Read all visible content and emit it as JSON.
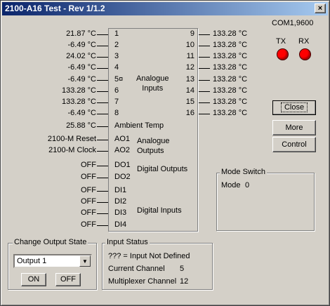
{
  "window": {
    "title": "2100-A16 Test - Rev 1/1.2",
    "close_glyph": "×"
  },
  "com_port": "COM1,9600",
  "leds": {
    "tx_label": "TX",
    "rx_label": "RX",
    "tx_color": "#ff0000",
    "rx_color": "#ff0000"
  },
  "left_values": [
    "21.87 °C",
    "-6.49 °C",
    "24.02 °C",
    "-6.49 °C",
    "-6.49 °C",
    "133.28 °C",
    "133.28 °C",
    "-6.49 °C"
  ],
  "left_pins": [
    "1",
    "2",
    "3",
    "4",
    "5¤",
    "6",
    "7",
    "8"
  ],
  "right_pins": [
    "9",
    "10",
    "11",
    "12",
    "13",
    "14",
    "15",
    "16"
  ],
  "right_values": [
    "133.28 °C",
    "133.28 °C",
    "133.28 °C",
    "133.28 °C",
    "133.28 °C",
    "133.28 °C",
    "133.28 °C",
    "133.28 °C"
  ],
  "analogue_inputs_label": "Analogue\nInputs",
  "ambient": {
    "value": "25.88 °C",
    "label": "Ambient Temp"
  },
  "analogue_outputs": {
    "label": "Analogue\nOutputs",
    "rows": [
      {
        "value": "2100-M Reset",
        "pin": "AO1"
      },
      {
        "value": "2100-M Clock",
        "pin": "AO2"
      }
    ]
  },
  "digital_outputs": {
    "label": "Digital Outputs",
    "rows": [
      {
        "value": "OFF",
        "pin": "DO1"
      },
      {
        "value": "OFF",
        "pin": "DO2"
      }
    ]
  },
  "digital_inputs": {
    "label": "Digital Inputs",
    "rows": [
      {
        "value": "OFF",
        "pin": "DI1"
      },
      {
        "value": "OFF",
        "pin": "DI2"
      },
      {
        "value": "OFF",
        "pin": "DI3"
      },
      {
        "value": "OFF",
        "pin": "DI4"
      }
    ]
  },
  "buttons": {
    "close": "Close",
    "more": "More",
    "control": "Control"
  },
  "mode_switch": {
    "title": "Mode Switch",
    "mode_label": "Mode",
    "mode_value": "0"
  },
  "change_output": {
    "title": "Change Output State",
    "selected": "Output 1",
    "on_label": "ON",
    "off_label": "OFF"
  },
  "input_status": {
    "title": "Input Status",
    "legend": "??? = Input Not Defined",
    "current_channel_label": "Current Channel",
    "current_channel_value": "5",
    "mux_channel_label": "Multiplexer Channel",
    "mux_channel_value": "12"
  }
}
